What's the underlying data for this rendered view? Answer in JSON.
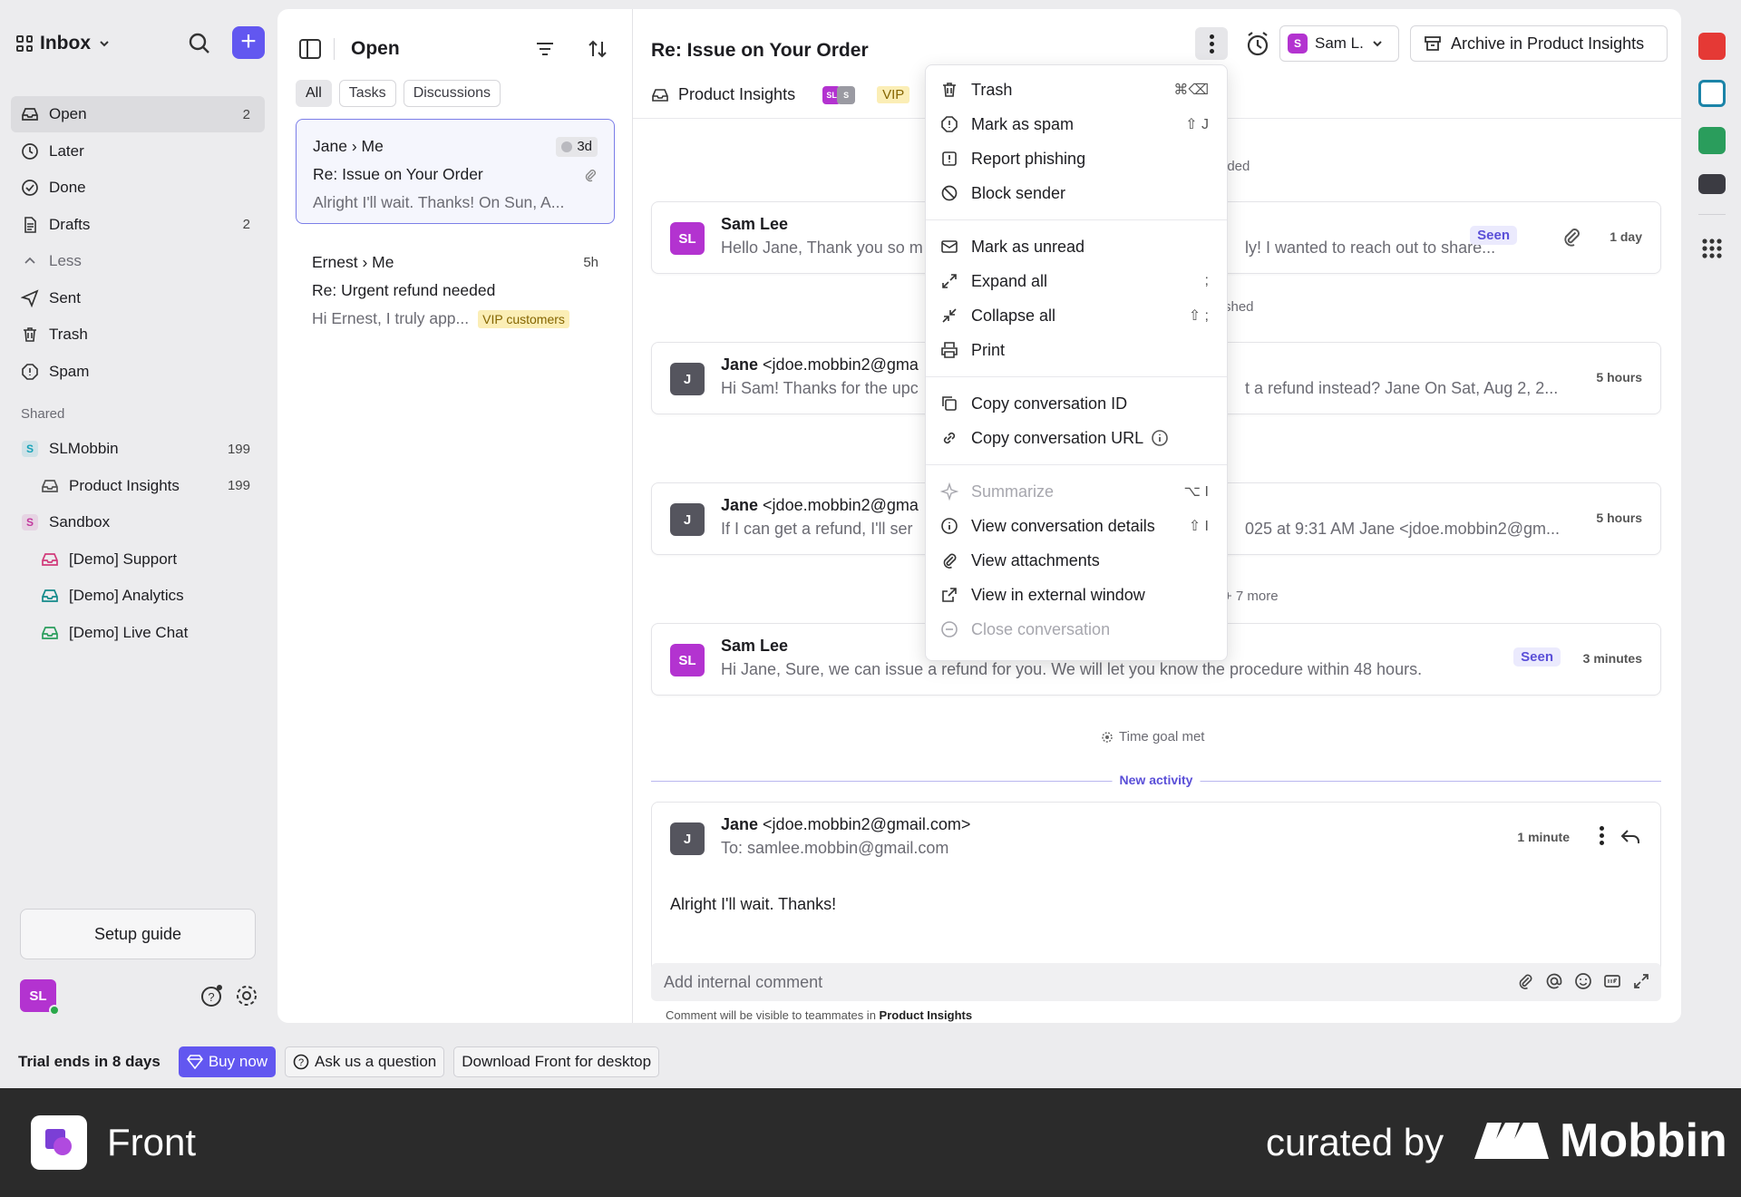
{
  "sidebar": {
    "inbox_label": "Inbox",
    "nav": [
      {
        "label": "Open",
        "count": "2",
        "icon": "inbox-icon"
      },
      {
        "label": "Later",
        "count": "",
        "icon": "clock-icon"
      },
      {
        "label": "Done",
        "count": "",
        "icon": "check-circle-icon"
      },
      {
        "label": "Drafts",
        "count": "2",
        "icon": "draft-icon"
      },
      {
        "label": "Less",
        "count": "",
        "icon": "chevron-up-icon"
      },
      {
        "label": "Sent",
        "count": "",
        "icon": "send-icon"
      },
      {
        "label": "Trash",
        "count": "",
        "icon": "trash-icon"
      },
      {
        "label": "Spam",
        "count": "",
        "icon": "spam-icon"
      }
    ],
    "shared_label": "Shared",
    "shared": [
      {
        "label": "SLMobbin",
        "count": "199",
        "icon": "S",
        "color": "#17a2b8"
      },
      {
        "label": "Product Insights",
        "count": "199",
        "icon": "inbox-icon",
        "color": "#555555"
      },
      {
        "label": "Sandbox",
        "count": "",
        "icon": "S",
        "color": "#c23a9e"
      },
      {
        "label": "[Demo] Support",
        "count": "",
        "icon": "inbox-icon",
        "color": "#d13a7a"
      },
      {
        "label": "[Demo] Analytics",
        "count": "",
        "icon": "inbox-icon",
        "color": "#138a8a"
      },
      {
        "label": "[Demo] Live Chat",
        "count": "",
        "icon": "inbox-icon",
        "color": "#2a9d5c"
      }
    ],
    "setup_guide": "Setup guide",
    "avatar_initials": "SL"
  },
  "list": {
    "title": "Open",
    "chips": [
      "All",
      "Tasks",
      "Discussions"
    ],
    "conversations": [
      {
        "from": "Jane",
        "to": "Me",
        "time": "3d",
        "subject": "Re: Issue on Your Order",
        "preview": "Alright I'll wait. Thanks! On Sun, A...",
        "tag": ""
      },
      {
        "from": "Ernest",
        "to": "Me",
        "time": "5h",
        "subject": "Re: Urgent refund needed",
        "preview": "Hi Ernest, I truly app...",
        "tag": "VIP customers"
      }
    ]
  },
  "main": {
    "title": "Re: Issue on Your Order",
    "assignee": "Sam L.",
    "assignee_initial": "S",
    "archive_label": "Archive in Product Insights",
    "inbox_name": "Product Insights",
    "vip_label": "VIP",
    "mini_avatars": [
      "SL",
      "S"
    ],
    "labels": {
      "added": "lded",
      "finished": "shed",
      "more": "+ 7 more",
      "time_goal": "Time goal met",
      "new_activity": "New activity"
    },
    "messages": [
      {
        "initials": "SL",
        "name": "Sam Lee",
        "email": "",
        "snippet_left": "Hello Jane, Thank you so m",
        "snippet_right": "ly! I wanted to reach out to share...",
        "time": "1 day",
        "seen": "Seen"
      },
      {
        "initials": "J",
        "name": "Jane",
        "email": "<jdoe.mobbin2@gma",
        "snippet_left": "Hi Sam! Thanks for the upc",
        "snippet_right": "t a refund instead? Jane On Sat, Aug 2, 2...",
        "time": "5 hours",
        "seen": ""
      },
      {
        "initials": "J",
        "name": "Jane",
        "email": "<jdoe.mobbin2@gma",
        "snippet_left": "If I can get a refund, I'll ser",
        "snippet_right": "025 at 9:31 AM Jane <jdoe.mobbin2@gm...",
        "time": "5 hours",
        "seen": ""
      },
      {
        "initials": "SL",
        "name": "Sam Lee",
        "email": "",
        "snippet_left": "Hi Jane, Sure, we can issue a refund for you. We will let you know the procedure within 48 hours.",
        "snippet_right": "",
        "time": "3 minutes",
        "seen": "Seen"
      }
    ],
    "latest": {
      "initials": "J",
      "name": "Jane",
      "email": "<jdoe.mobbin2@gmail.com>",
      "to": "To: samlee.mobbin@gmail.com",
      "time": "1 minute",
      "body": "Alright I'll wait. Thanks!"
    },
    "comment_placeholder": "Add internal comment",
    "comment_note_prefix": "Comment will be visible to teammates in ",
    "comment_note_inbox": "Product Insights"
  },
  "menu": {
    "groups": [
      [
        {
          "label": "Trash",
          "shortcut": "⌘⌫",
          "icon": "trash-icon",
          "disabled": false
        },
        {
          "label": "Mark as spam",
          "shortcut": "⇧ J",
          "icon": "spam-icon",
          "disabled": false
        },
        {
          "label": "Report phishing",
          "shortcut": "",
          "icon": "alert-icon",
          "disabled": false
        },
        {
          "label": "Block sender",
          "shortcut": "",
          "icon": "block-icon",
          "disabled": false
        }
      ],
      [
        {
          "label": "Mark as unread",
          "shortcut": "",
          "icon": "mail-icon",
          "disabled": false
        },
        {
          "label": "Expand all",
          "shortcut": ";",
          "icon": "expand-icon",
          "disabled": false
        },
        {
          "label": "Collapse all",
          "shortcut": "⇧ ;",
          "icon": "collapse-icon",
          "disabled": false
        },
        {
          "label": "Print",
          "shortcut": "",
          "icon": "print-icon",
          "disabled": false
        }
      ],
      [
        {
          "label": "Copy conversation ID",
          "shortcut": "",
          "icon": "copy-icon",
          "disabled": false
        },
        {
          "label": "Copy conversation URL",
          "shortcut": "",
          "icon": "link-icon",
          "disabled": false
        }
      ],
      [
        {
          "label": "Summarize",
          "shortcut": "⌥ I",
          "icon": "sparkle-icon",
          "disabled": true
        },
        {
          "label": "View conversation details",
          "shortcut": "⇧ I",
          "icon": "info-icon",
          "disabled": false
        },
        {
          "label": "View attachments",
          "shortcut": "",
          "icon": "paperclip-icon",
          "disabled": false
        },
        {
          "label": "View in external window",
          "shortcut": "",
          "icon": "external-icon",
          "disabled": false
        },
        {
          "label": "Close conversation",
          "shortcut": "",
          "icon": "minus-circle-icon",
          "disabled": true
        }
      ]
    ]
  },
  "trial": {
    "text": "Trial ends in 8 days",
    "buy": "Buy now",
    "ask": "Ask us a question",
    "download": "Download Front for desktop"
  },
  "footer": {
    "brand": "Front",
    "curated": "curated by",
    "mobbin": "Mobbin"
  },
  "colors": {
    "accent": "#6257f0",
    "avatar_purple": "#b333d0",
    "avatar_grey": "#55555e",
    "vip_bg": "#fbeeb6",
    "rail_calendar": "#e53935",
    "rail_contacts": "#1b84a8",
    "rail_book": "#2a9d5c",
    "footer_bg": "#2b2b2b"
  }
}
